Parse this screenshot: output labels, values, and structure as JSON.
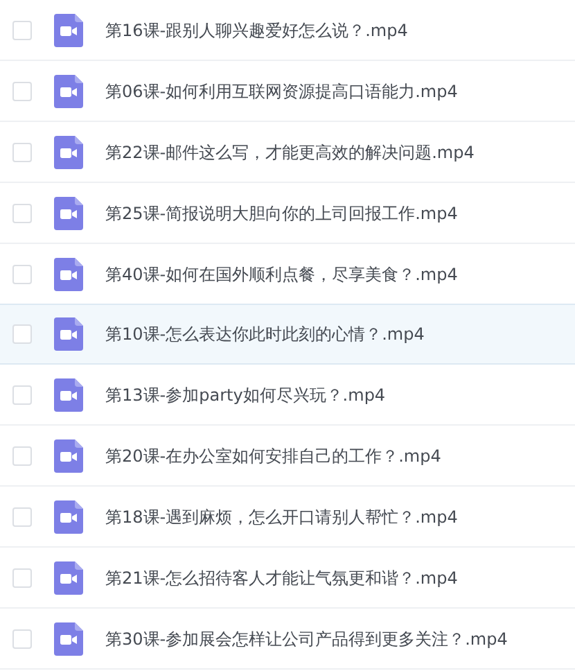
{
  "files": [
    {
      "name": "第16课-跟别人聊兴趣爱好怎么说？.mp4",
      "checked": false,
      "highlighted": false
    },
    {
      "name": "第06课-如何利用互联网资源提高口语能力.mp4",
      "checked": false,
      "highlighted": false
    },
    {
      "name": "第22课-邮件这么写，才能更高效的解决问题.mp4",
      "checked": false,
      "highlighted": false
    },
    {
      "name": "第25课-简报说明大胆向你的上司回报工作.mp4",
      "checked": false,
      "highlighted": false
    },
    {
      "name": "第40课-如何在国外顺利点餐，尽享美食？.mp4",
      "checked": false,
      "highlighted": false
    },
    {
      "name": "第10课-怎么表达你此时此刻的心情？.mp4",
      "checked": false,
      "highlighted": true
    },
    {
      "name": "第13课-参加party如何尽兴玩？.mp4",
      "checked": false,
      "highlighted": false
    },
    {
      "name": "第20课-在办公室如何安排自己的工作？.mp4",
      "checked": false,
      "highlighted": false
    },
    {
      "name": "第18课-遇到麻烦，怎么开口请别人帮忙？.mp4",
      "checked": false,
      "highlighted": false
    },
    {
      "name": "第21课-怎么招待客人才能让气氛更和谐？.mp4",
      "checked": false,
      "highlighted": false
    },
    {
      "name": "第30课-参加展会怎样让公司产品得到更多关注？.mp4",
      "checked": false,
      "highlighted": false
    }
  ]
}
